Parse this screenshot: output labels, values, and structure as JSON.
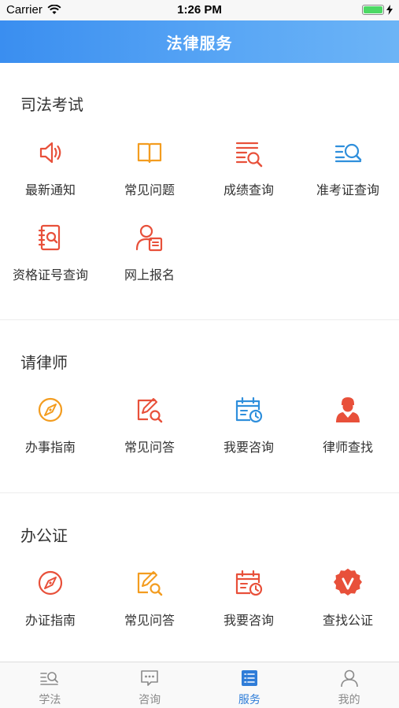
{
  "status_bar": {
    "carrier": "Carrier",
    "time": "1:26 PM"
  },
  "header": {
    "title": "法律服务"
  },
  "sections": [
    {
      "title": "司法考试",
      "items": [
        {
          "label": "最新通知",
          "icon": "speaker-icon",
          "color": "#e8503a"
        },
        {
          "label": "常见问题",
          "icon": "book-icon",
          "color": "#f39c1f"
        },
        {
          "label": "成绩查询",
          "icon": "list-search-icon",
          "color": "#e8503a"
        },
        {
          "label": "准考证查询",
          "icon": "list-search-icon",
          "color": "#2f8fdc"
        },
        {
          "label": "资格证号查询",
          "icon": "certificate-search-icon",
          "color": "#e8503a"
        },
        {
          "label": "网上报名",
          "icon": "person-form-icon",
          "color": "#e8503a"
        }
      ]
    },
    {
      "title": "请律师",
      "items": [
        {
          "label": "办事指南",
          "icon": "compass-icon",
          "color": "#f39c1f"
        },
        {
          "label": "常见问答",
          "icon": "edit-search-icon",
          "color": "#e8503a"
        },
        {
          "label": "我要咨询",
          "icon": "calendar-clock-icon",
          "color": "#2f8fdc"
        },
        {
          "label": "律师查找",
          "icon": "lawyer-icon",
          "color": "#e8503a"
        }
      ]
    },
    {
      "title": "办公证",
      "items": [
        {
          "label": "办证指南",
          "icon": "compass-icon",
          "color": "#e8503a"
        },
        {
          "label": "常见问答",
          "icon": "edit-search-icon",
          "color": "#f39c1f"
        },
        {
          "label": "我要咨询",
          "icon": "calendar-clock-icon",
          "color": "#e8503a"
        },
        {
          "label": "查找公证",
          "icon": "v-badge-icon",
          "color": "#e8503a"
        }
      ]
    }
  ],
  "tabbar": {
    "items": [
      {
        "label": "学法",
        "icon": "list-search-icon",
        "active": false
      },
      {
        "label": "咨询",
        "icon": "chat-icon",
        "active": false
      },
      {
        "label": "服务",
        "icon": "list-icon",
        "active": true
      },
      {
        "label": "我的",
        "icon": "person-icon",
        "active": false
      }
    ],
    "active_color": "#2f7dd8",
    "inactive_color": "#8a8a8a"
  }
}
